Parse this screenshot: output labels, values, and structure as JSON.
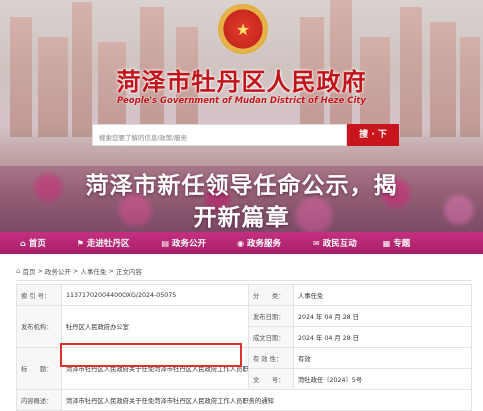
{
  "header": {
    "title": "菏泽市牡丹区人民政府",
    "english_title": "People's Government of Mudan District of Heze City",
    "emblem_icon": "national-emblem-icon",
    "brand_color": "#c2121a"
  },
  "search": {
    "placeholder": "搜索您要了解的信息/政策/服务",
    "button_label": "搜 · 下"
  },
  "overlay": {
    "headline_line1": "菏泽市新任领导任命公示，揭",
    "headline_line2": "开新篇章"
  },
  "nav": {
    "items": [
      {
        "label": "首页",
        "icon": "home-icon"
      },
      {
        "label": "走进牡丹区",
        "icon": "flag-icon"
      },
      {
        "label": "政务公开",
        "icon": "document-icon"
      },
      {
        "label": "政务服务",
        "icon": "service-icon"
      },
      {
        "label": "政民互动",
        "icon": "chat-icon"
      },
      {
        "label": "专题",
        "icon": "grid-icon"
      }
    ],
    "color": "#b8277a"
  },
  "breadcrumb": {
    "items": [
      "首页",
      "政务公开",
      "人事任免",
      "正文内容"
    ],
    "separator": ">"
  },
  "doc_table": {
    "rows": [
      {
        "l1": "索 引 号：",
        "v1": "11371702004400OXG/2024-05075",
        "l2": "分　　类：",
        "v2": "人事任免"
      },
      {
        "l1": "发布机构：",
        "v1": "牡丹区人民政府办公室",
        "l2": "发布日期：",
        "v2": "2024 年 04 月 28 日"
      },
      {
        "l1": "",
        "v1": "",
        "l2": "成文日期：",
        "v2": "2024 年 04 月 28 日"
      },
      {
        "l1": "标　　题：",
        "v1": "菏泽市牡丹区人民政府关于任免菏泽市牡丹区人民政府工作人员职务的通知",
        "l2": "有 效 性：",
        "v2": "有效"
      },
      {
        "l1": "",
        "v1": "",
        "l2": "文　　号：",
        "v2": "菏牡政任〔2024〕5号"
      },
      {
        "l1": "内容概述：",
        "v1": "菏泽市牡丹区人民政府关于任免菏泽市牡丹区人民政府工作人员职务的通知",
        "l2": "",
        "v2": ""
      }
    ],
    "highlight_color": "#e0302a"
  }
}
